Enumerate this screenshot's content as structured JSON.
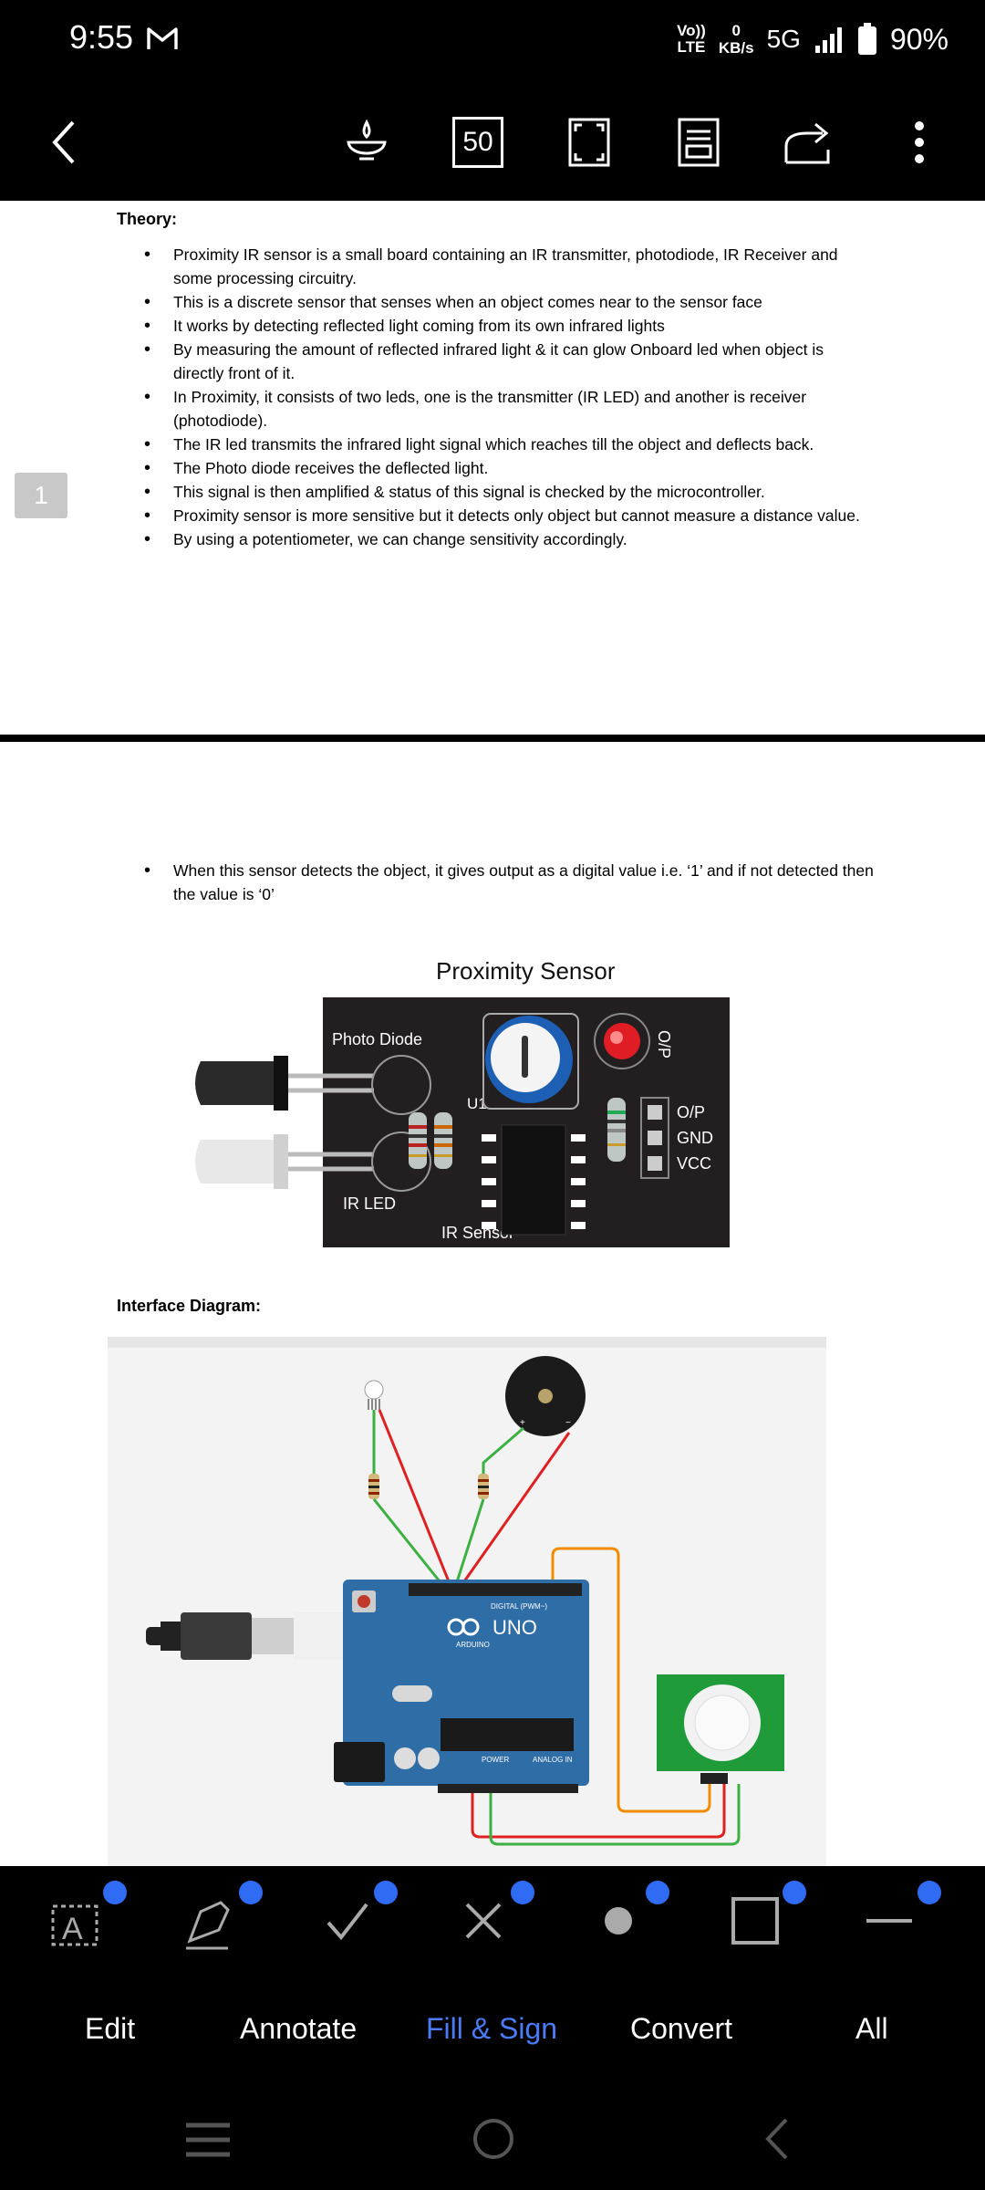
{
  "status_bar": {
    "time": "9:55",
    "volte": "Vo)) LTE",
    "net_speed_value": "0",
    "net_speed_unit": "KB/s",
    "network": "5G",
    "battery": "90%"
  },
  "toolbar": {
    "zoom": "50",
    "icons": [
      "back-icon",
      "lamp-icon",
      "zoom-percent",
      "fit-page-icon",
      "read-mode-icon",
      "share-icon",
      "more-icon"
    ]
  },
  "page1": {
    "heading": "Theory:",
    "bullets": [
      "Proximity IR sensor is a small board containing an IR transmitter, photodiode, IR Receiver and some processing circuitry.",
      "This is a discrete sensor that senses when an object comes near to the sensor face",
      "It works by detecting reflected light coming from its own infrared lights",
      "By measuring the amount of reflected infrared light & it can glow Onboard led when object is directly front of it.",
      "In Proximity, it consists of two leds, one is the transmitter (IR LED) and another is receiver (photodiode).",
      "The IR led transmits the infrared light signal which reaches till the object and deflects back.",
      "The Photo diode receives the deflected light.",
      "This signal is then amplified & status of this signal is checked by the microcontroller.",
      "Proximity sensor is more sensitive but it detects only object but cannot measure a distance value.",
      "By using a potentiometer, we can change sensitivity accordingly."
    ],
    "page_number": "1"
  },
  "page2": {
    "bullets": [
      "When this sensor detects the object, it gives output as a digital value i.e. ‘1’ and if not detected then the value is ‘0’"
    ],
    "figure_title": "Proximity Sensor",
    "sensor_labels": {
      "photo_diode": "Photo Diode",
      "ir_led": "IR LED",
      "u1": "U1",
      "ir_sensor": "IR Sensor",
      "op_vertical": "O/P",
      "pin1": "O/P",
      "pin2": "GND",
      "pin3": "VCC"
    },
    "interface_heading": "Interface Diagram:",
    "arduino_labels": {
      "uno": "UNO",
      "brand": "ARDUINO",
      "digital": "DIGITAL (PWM~)",
      "power": "POWER",
      "analog": "ANALOG IN"
    }
  },
  "bottom_tools": [
    "text-box-tool",
    "signature-tool",
    "check-tool",
    "cross-tool",
    "dot-tool",
    "rectangle-tool",
    "line-tool"
  ],
  "tabs": [
    {
      "label": "Edit",
      "active": false
    },
    {
      "label": "Annotate",
      "active": false
    },
    {
      "label": "Fill & Sign",
      "active": true
    },
    {
      "label": "Convert",
      "active": false
    },
    {
      "label": "All",
      "active": false
    }
  ],
  "colors": {
    "accent": "#4a7cf7",
    "bolt_badge": "#2f6bf3",
    "arduino_board": "#2f6da6",
    "pir_board": "#1f9b3a"
  }
}
